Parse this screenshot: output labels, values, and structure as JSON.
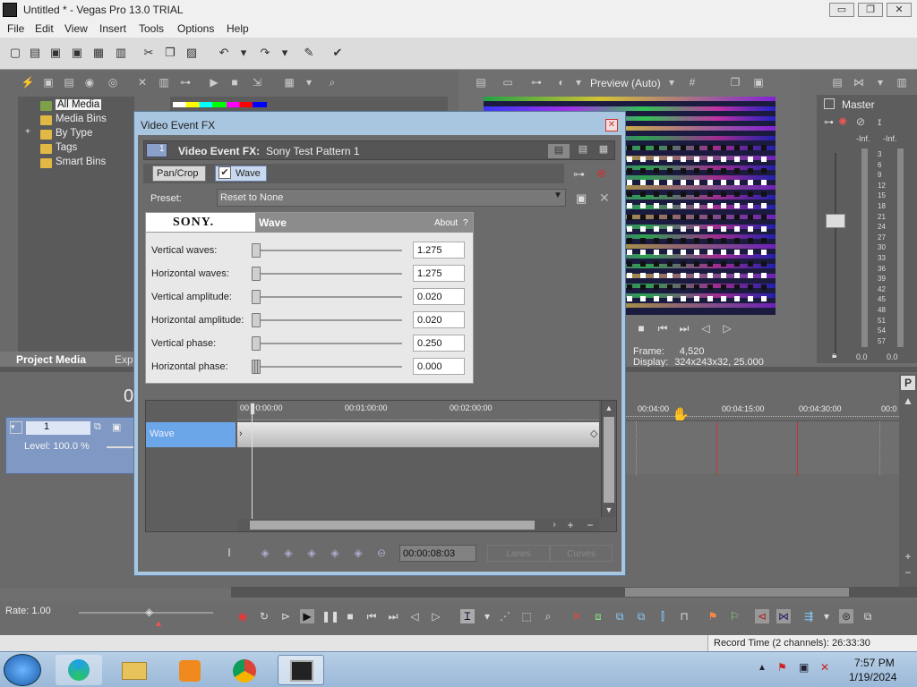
{
  "window": {
    "title": "Untitled * - Vegas Pro 13.0 TRIAL",
    "minimize": "▭",
    "restore": "❐",
    "close": "✕"
  },
  "menu": [
    "File",
    "Edit",
    "View",
    "Insert",
    "Tools",
    "Options",
    "Help"
  ],
  "explorer": {
    "tree": [
      "All Media",
      "Media Bins",
      "By Type",
      "Tags",
      "Smart Bins"
    ],
    "expander": "+",
    "tabs": {
      "project_media": "Project Media",
      "explorer": "Expl"
    }
  },
  "preview": {
    "quality": "Preview (Auto)",
    "frame_label": "Frame:",
    "frame_value": "4,520",
    "display_label": "Display:",
    "display_value": "324x243x32, 25.000"
  },
  "master": {
    "title": "Master",
    "inf_left": "-Inf.",
    "inf_right": "-Inf.",
    "scale": [
      "3",
      "6",
      "9",
      "12",
      "15",
      "18",
      "21",
      "24",
      "27",
      "30",
      "33",
      "36",
      "39",
      "42",
      "45",
      "48",
      "51",
      "54",
      "57"
    ],
    "bottom_left": "0.0",
    "bottom_right": "0.0"
  },
  "track": {
    "number": "1",
    "level": "Level: 100.0 %",
    "time_digit": "0"
  },
  "dialog": {
    "title": "Video Event FX",
    "close": "✕",
    "chain_num": "1",
    "fx_label": "Video Event FX:",
    "fx_name": "Sony Test Pattern 1",
    "chain": [
      "Pan/Crop",
      "Wave"
    ],
    "preset_label": "Preset:",
    "preset_value": "Reset to None",
    "brand": "SONY.",
    "plugin_name": "Wave",
    "about": "About",
    "help": "?",
    "params": [
      {
        "label": "Vertical waves:",
        "value": "1.275",
        "pos": 0
      },
      {
        "label": "Horizontal waves:",
        "value": "1.275",
        "pos": 0
      },
      {
        "label": "Vertical amplitude:",
        "value": "0.020",
        "pos": 0
      },
      {
        "label": "Horizontal amplitude:",
        "value": "0.020",
        "pos": 0
      },
      {
        "label": "Vertical phase:",
        "value": "0.250",
        "pos": 0
      },
      {
        "label": "Horizontal phase:",
        "value": "0.000",
        "pos": 0
      }
    ],
    "keyframe_ruler": [
      "00:00:00:00",
      "00:01:00:00",
      "00:02:00:00"
    ],
    "keyframe_track": "Wave",
    "timecode": "00:00:08:03",
    "lanes": "Lanes",
    "curves": "Curves"
  },
  "timeline": {
    "ruler": [
      "00:04:00",
      "00:04:15:00",
      "00:04:30:00",
      "00:0"
    ]
  },
  "transport": {
    "rate": "Rate: 1.00"
  },
  "status": {
    "record_time": "Record Time (2 channels): 26:33:30"
  },
  "taskbar": {
    "time": "7:57 PM",
    "date": "1/19/2024"
  }
}
